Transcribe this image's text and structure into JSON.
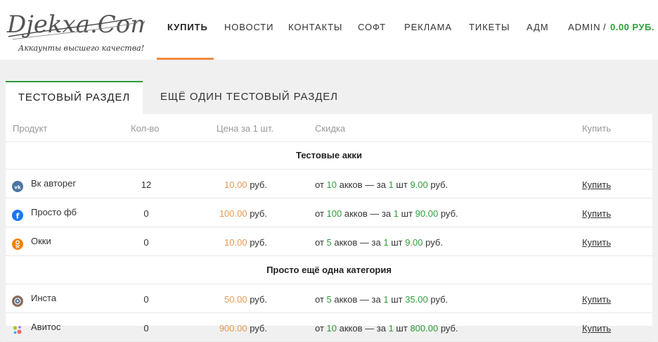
{
  "logo": {
    "brand": "Djekxa.Com",
    "tagline": "Аккаунты высшего качества!"
  },
  "nav": {
    "items": [
      "КУПИТЬ",
      "НОВОСТИ",
      "КОНТАКТЫ",
      "СОФТ",
      "РЕКЛАМА",
      "ТИКЕТЫ",
      "АДМ",
      "ADMIN"
    ],
    "active_index": 0,
    "balance_sep": "/",
    "balance": "0.00 РУБ."
  },
  "tabs": [
    "ТЕСТОВЫЙ РАЗДЕЛ",
    "ЕЩЁ ОДИН ТЕСТОВЫЙ РАЗДЕЛ"
  ],
  "table": {
    "headers": {
      "product": "Продукт",
      "qty": "Кол-во",
      "price": "Цена за 1 шт.",
      "discount": "Скидка",
      "buy": "Купить"
    },
    "categories": [
      "Тестовые акки",
      "Просто ещё одна категория"
    ],
    "rows": [
      {
        "icon": "vk-icon",
        "icon_color": "#4c75a3",
        "name": "Вк авторег",
        "qty": "12",
        "price": "10.00",
        "currency": "руб.",
        "d_prefix": "от",
        "d_count": "10",
        "d_mid": "акков — за",
        "d_one": "1",
        "d_unit": "шт",
        "d_price": "9.00",
        "d_currency": "руб.",
        "buy": "Купить"
      },
      {
        "icon": "facebook-icon",
        "icon_color": "#1877f2",
        "name": "Просто фб",
        "qty": "0",
        "price": "100.00",
        "currency": "руб.",
        "d_prefix": "от",
        "d_count": "100",
        "d_mid": "акков — за",
        "d_one": "1",
        "d_unit": "шт",
        "d_price": "90.00",
        "d_currency": "руб.",
        "buy": "Купить"
      },
      {
        "icon": "odnoklassniki-icon",
        "icon_color": "#ee8208",
        "name": "Окки",
        "qty": "0",
        "price": "10.00",
        "currency": "руб.",
        "d_prefix": "от",
        "d_count": "5",
        "d_mid": "акков — за",
        "d_one": "1",
        "d_unit": "шт",
        "d_price": "9.00",
        "d_currency": "руб.",
        "buy": "Купить"
      },
      {
        "icon": "instagram-icon",
        "icon_color": "#8a6d5a",
        "name": "Инста",
        "qty": "0",
        "price": "50.00",
        "currency": "руб.",
        "d_prefix": "от",
        "d_count": "5",
        "d_mid": "акков — за",
        "d_one": "1",
        "d_unit": "шт",
        "d_price": "35.00",
        "d_currency": "руб.",
        "buy": "Купить"
      },
      {
        "icon": "avito-icon",
        "icon_color": "#97cf26",
        "name": "Авитос",
        "qty": "0",
        "price": "900.00",
        "currency": "руб.",
        "d_prefix": "от",
        "d_count": "10",
        "d_mid": "акков — за",
        "d_one": "1",
        "d_unit": "шт",
        "d_price": "800.00",
        "d_currency": "руб.",
        "buy": "Купить"
      }
    ]
  }
}
